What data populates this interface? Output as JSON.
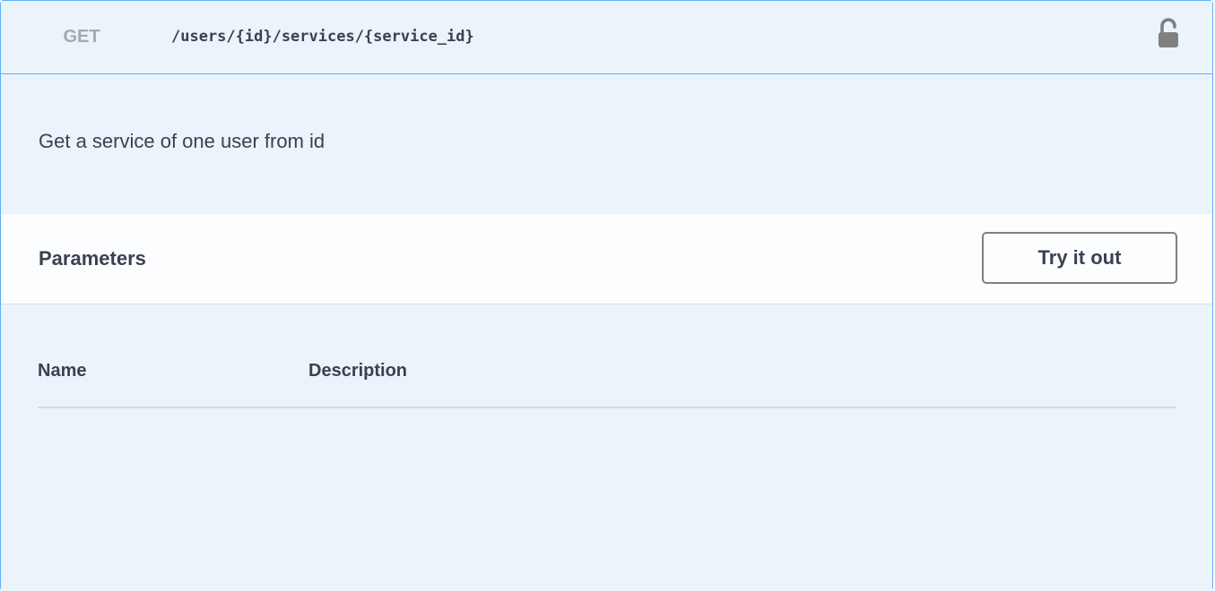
{
  "operation": {
    "method": "GET",
    "path": "/users/{id}/services/{service_id}",
    "description": "Get a service of one user from id",
    "lock_icon": "unlocked-padlock-icon"
  },
  "parameters_section": {
    "title": "Parameters",
    "try_it_out_label": "Try it out",
    "columns": [
      "Name",
      "Description"
    ]
  },
  "colors": {
    "border_blue": "#61affe",
    "background_tint": "#ebf3fb",
    "text": "#3b4151",
    "method_gray": "#a8a8a8"
  }
}
